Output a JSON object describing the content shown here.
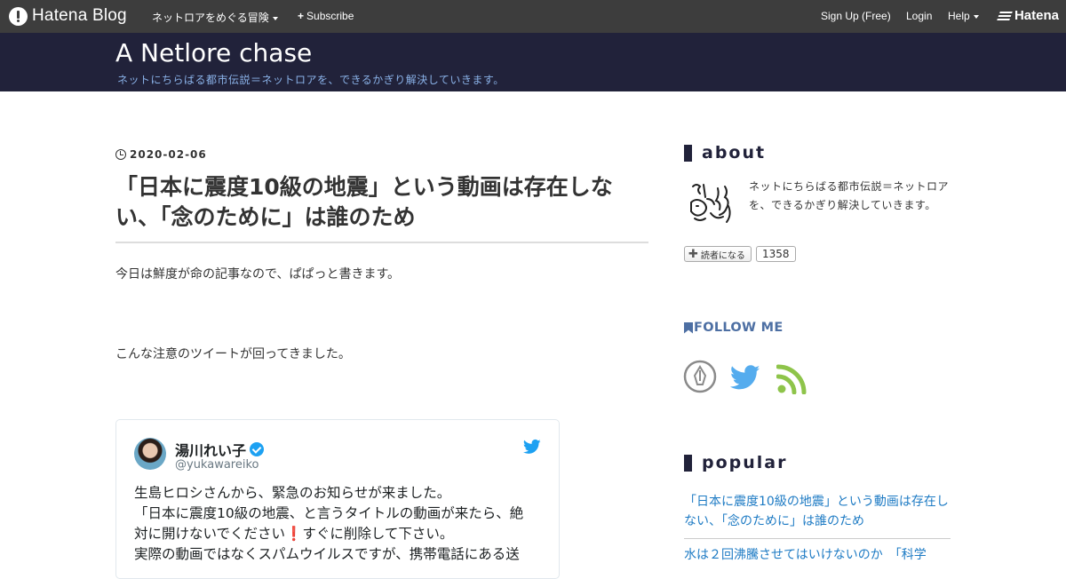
{
  "topbar": {
    "logo_text": "Hatena Blog",
    "blog_menu": "ネットロアをめぐる冒険",
    "subscribe": "Subscribe",
    "signup": "Sign Up (Free)",
    "login": "Login",
    "help": "Help",
    "brand": "Hatena"
  },
  "header": {
    "title": "A Netlore chase",
    "description": "ネットにちらばる都市伝説＝ネットロアを、できるかぎり解決していきます。"
  },
  "entry": {
    "date": "2020-02-06",
    "title": "「日本に震度10級の地震」という動画は存在しない、「念のために」は誰のため",
    "para1": "今日は鮮度が命の記事なので、ぱぱっと書きます。",
    "para2": "こんな注意のツイートが回ってきました。"
  },
  "tweet": {
    "name": "湯川れい子",
    "handle": "@yukawareiko",
    "line1": "生島ヒロシさんから、緊急のお知らせが来ました。",
    "line2": "「日本に震度10級の地震、と言うタイトルの動画が来たら、絶",
    "line3a": "対に開けないでください",
    "line3_mark": "❗",
    "line3b": "すぐに削除して下さい。",
    "line4": "実際の動画ではなくスパムウイルスですが、携帯電話にある送"
  },
  "sidebar": {
    "about_head": "about",
    "about_text": "ネットにちらばる都市伝説＝ネットロアを、できるかぎり解決していきます。",
    "reader_button": "読者になる",
    "reader_count": "1358",
    "follow_head": "FOLLOW ME",
    "popular_head": "popular",
    "popular_1": "「日本に震度10級の地震」という動画は存在しない、「念のために」は誰のため",
    "popular_2": "水は２回沸騰させてはいけないのか　「科学"
  },
  "colors": {
    "topbar": "#3d3d3d",
    "header": "#21223a",
    "header_desc": "#8ab2e8",
    "link": "#1e7bc4",
    "twitter": "#1da1f2",
    "rss": "#8ec44a"
  }
}
